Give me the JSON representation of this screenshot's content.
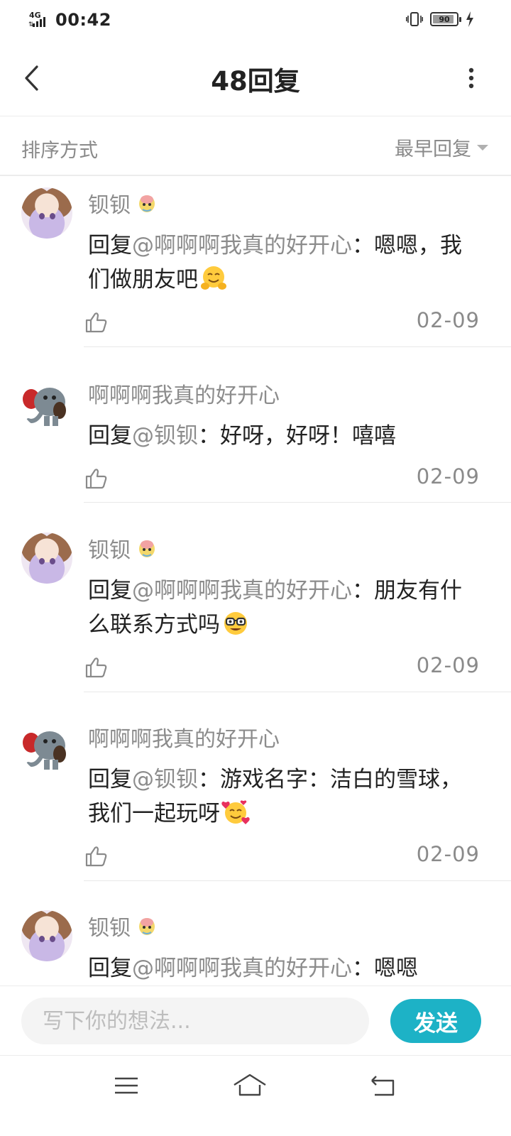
{
  "status_bar": {
    "network": "4G",
    "time": "00:42",
    "battery_level": "90",
    "battery_fraction": 0.9
  },
  "header": {
    "title": "48回复"
  },
  "sort": {
    "label": "排序方式",
    "value": "最早回复"
  },
  "replies": [
    {
      "username": "钡钡",
      "prefix": "回复",
      "mention": "@啊啊啊我真的好开心",
      "text": "：嗯嗯，我们做朋友吧",
      "emoji": "hugging-face-emoji",
      "date": "02-09"
    },
    {
      "username": "啊啊啊我真的好开心",
      "prefix": "回复",
      "mention": "@钡钡",
      "text": "：好呀，好呀！嘻嘻",
      "emoji": "",
      "date": "02-09"
    },
    {
      "username": "钡钡",
      "prefix": "回复",
      "mention": "@啊啊啊我真的好开心",
      "text": "：朋友有什么联系方式吗",
      "emoji": "nerd-face-emoji",
      "date": "02-09"
    },
    {
      "username": "啊啊啊我真的好开心",
      "prefix": "回复",
      "mention": "@钡钡",
      "text": "：游戏名字：洁白的雪球，我们一起玩呀",
      "emoji": "smiling-face-with-hearts-emoji",
      "date": "02-09"
    },
    {
      "username": "钡钡",
      "prefix": "回复",
      "mention": "@啊啊啊我真的好开心",
      "text": "：嗯嗯",
      "emoji": "",
      "date": ""
    }
  ],
  "input": {
    "placeholder": "写下你的想法...",
    "send_label": "发送"
  },
  "colors": {
    "accent": "#1db2c6",
    "muted_text": "#8c8c8c",
    "primary_text": "#222222"
  }
}
